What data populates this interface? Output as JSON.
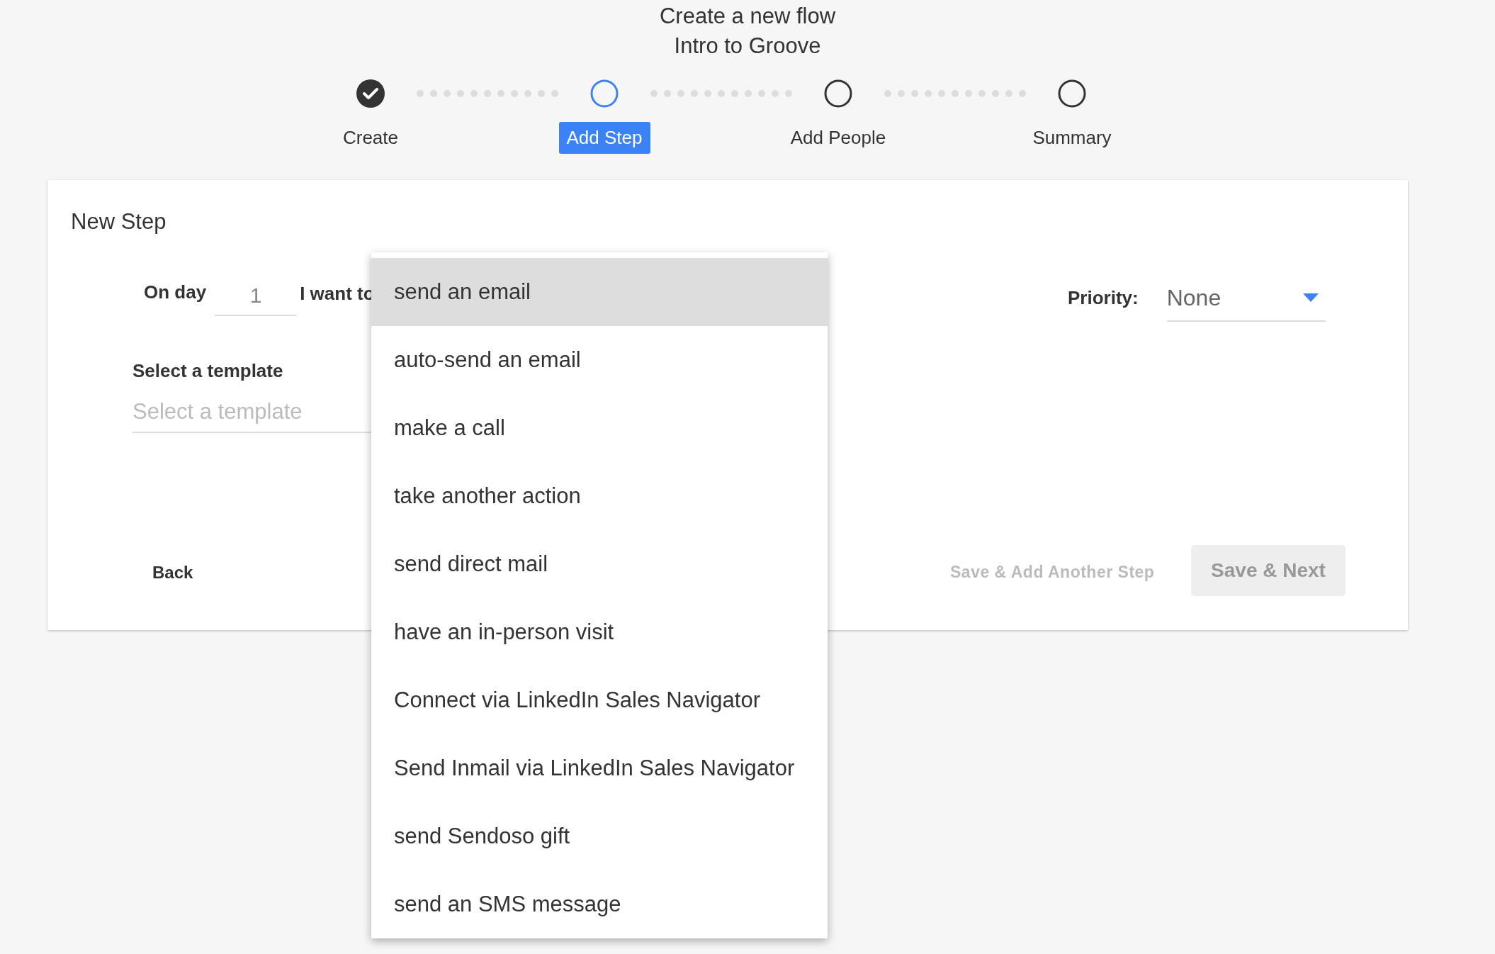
{
  "header": {
    "title": "Create a new flow",
    "subtitle": "Intro to Groove"
  },
  "steps": [
    {
      "label": "Create",
      "completed": true,
      "selected": false
    },
    {
      "label": "Add Step",
      "completed": false,
      "selected": true
    },
    {
      "label": "Add People",
      "completed": false,
      "selected": false
    },
    {
      "label": "Summary",
      "completed": false,
      "selected": false
    }
  ],
  "card": {
    "title": "New Step",
    "day_label": "On day",
    "day_value": "1",
    "action_label": "I want to",
    "template_label": "Select a template",
    "template_placeholder": "Select a template",
    "priority_label": "Priority:",
    "priority_value": "None",
    "back": "Back",
    "save_add": {
      "label": "Save & Add Another Step",
      "disabled": true
    },
    "save_next": {
      "label": "Save & Next",
      "disabled": true
    }
  },
  "action_menu": [
    {
      "label": "send an email",
      "highlighted": true
    },
    {
      "label": "auto-send an email",
      "highlighted": false
    },
    {
      "label": "make a call",
      "highlighted": false
    },
    {
      "label": "take another action",
      "highlighted": false
    },
    {
      "label": "send direct mail",
      "highlighted": false
    },
    {
      "label": "have an in-person visit",
      "highlighted": false
    },
    {
      "label": "Connect via LinkedIn Sales Navigator",
      "highlighted": false
    },
    {
      "label": "Send Inmail via LinkedIn Sales Navigator",
      "highlighted": false
    },
    {
      "label": "send Sendoso gift",
      "highlighted": false
    },
    {
      "label": "send an SMS message",
      "highlighted": false
    }
  ]
}
